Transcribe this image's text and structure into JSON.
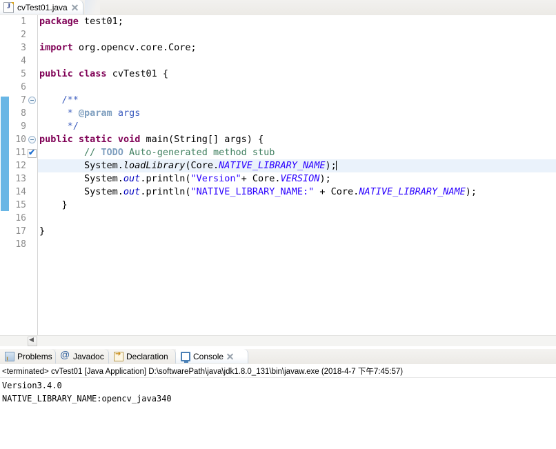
{
  "editor": {
    "tab": {
      "label": "cvTest01.java",
      "icon": "java-file-icon",
      "close_icon": "close-icon"
    },
    "lines": [
      {
        "n": "1",
        "fold": false,
        "mark": false
      },
      {
        "n": "2",
        "fold": false,
        "mark": false
      },
      {
        "n": "3",
        "fold": false,
        "mark": false
      },
      {
        "n": "4",
        "fold": false,
        "mark": false
      },
      {
        "n": "5",
        "fold": false,
        "mark": false
      },
      {
        "n": "6",
        "fold": false,
        "mark": false
      },
      {
        "n": "7",
        "fold": true,
        "mark": false
      },
      {
        "n": "8",
        "fold": false,
        "mark": false
      },
      {
        "n": "9",
        "fold": false,
        "mark": false
      },
      {
        "n": "10",
        "fold": true,
        "mark": false
      },
      {
        "n": "11",
        "fold": false,
        "mark": true
      },
      {
        "n": "12",
        "fold": false,
        "mark": false
      },
      {
        "n": "13",
        "fold": false,
        "mark": false
      },
      {
        "n": "14",
        "fold": false,
        "mark": false
      },
      {
        "n": "15",
        "fold": false,
        "mark": false
      },
      {
        "n": "16",
        "fold": false,
        "mark": false
      },
      {
        "n": "17",
        "fold": false,
        "mark": false
      },
      {
        "n": "18",
        "fold": false,
        "mark": false
      }
    ],
    "code": {
      "l1_kw": "package",
      "l1_rest": " test01;",
      "l3_kw": "import",
      "l3_rest": " org.opencv.core.Core;",
      "l5_kw1": "public",
      "l5_kw2": "class",
      "l5_rest": " cvTest01 {",
      "l7": "    /**",
      "l8_pre": "     * ",
      "l8_tag": "@param",
      "l8_post": " args",
      "l9": "     */",
      "l10_kw1": "public",
      "l10_kw2": "static",
      "l10_kw3": "void",
      "l10_rest": " main(String[] args) {",
      "l11_pre": "        // ",
      "l11_todo": "TODO",
      "l11_post": " Auto-generated method stub",
      "l12_a": "        System.",
      "l12_b": "loadLibrary",
      "l12_c": "(Core.",
      "l12_d": "NATIVE_LIBRARY_NAME",
      "l12_e": ");",
      "l13_a": "        System.",
      "l13_b": "out",
      "l13_c": ".println(",
      "l13_d": "\"Version\"",
      "l13_e": "+ Core.",
      "l13_f": "VERSION",
      "l13_g": ");",
      "l14_a": "        System.",
      "l14_b": "out",
      "l14_c": ".println(",
      "l14_d": "\"NATIVE_LIBRARY_NAME:\"",
      "l14_e": " + Core.",
      "l14_f": "NATIVE_LIBRARY_NAME",
      "l14_g": ");",
      "l15": "    }",
      "l17": "}"
    },
    "scrollbar": {
      "left_arrow_icon": "scroll-left-arrow-icon"
    }
  },
  "bottom_panel": {
    "tabs": [
      {
        "label": "Problems",
        "icon": "problems-icon",
        "active": false,
        "closable": false
      },
      {
        "label": "Javadoc",
        "icon": "javadoc-icon",
        "active": false,
        "closable": false
      },
      {
        "label": "Declaration",
        "icon": "declaration-icon",
        "active": false,
        "closable": false
      },
      {
        "label": "Console",
        "icon": "console-icon",
        "active": true,
        "closable": true
      }
    ],
    "console": {
      "header": "<terminated> cvTest01 [Java Application] D:\\softwarePath\\java\\jdk1.8.0_131\\bin\\javaw.exe (2018-4-7 下午7:45:57)",
      "output_lines": [
        "Version3.4.0",
        "NATIVE_LIBRARY_NAME:opencv_java340"
      ]
    }
  },
  "colors": {
    "keyword": "#7f0055",
    "string": "#2a00ff",
    "comment": "#3f7f5f",
    "javadoc": "#3f5fbf",
    "field": "#0000c0",
    "current_line": "#eaf2fb",
    "annotation_bar": "#61b2e4"
  }
}
